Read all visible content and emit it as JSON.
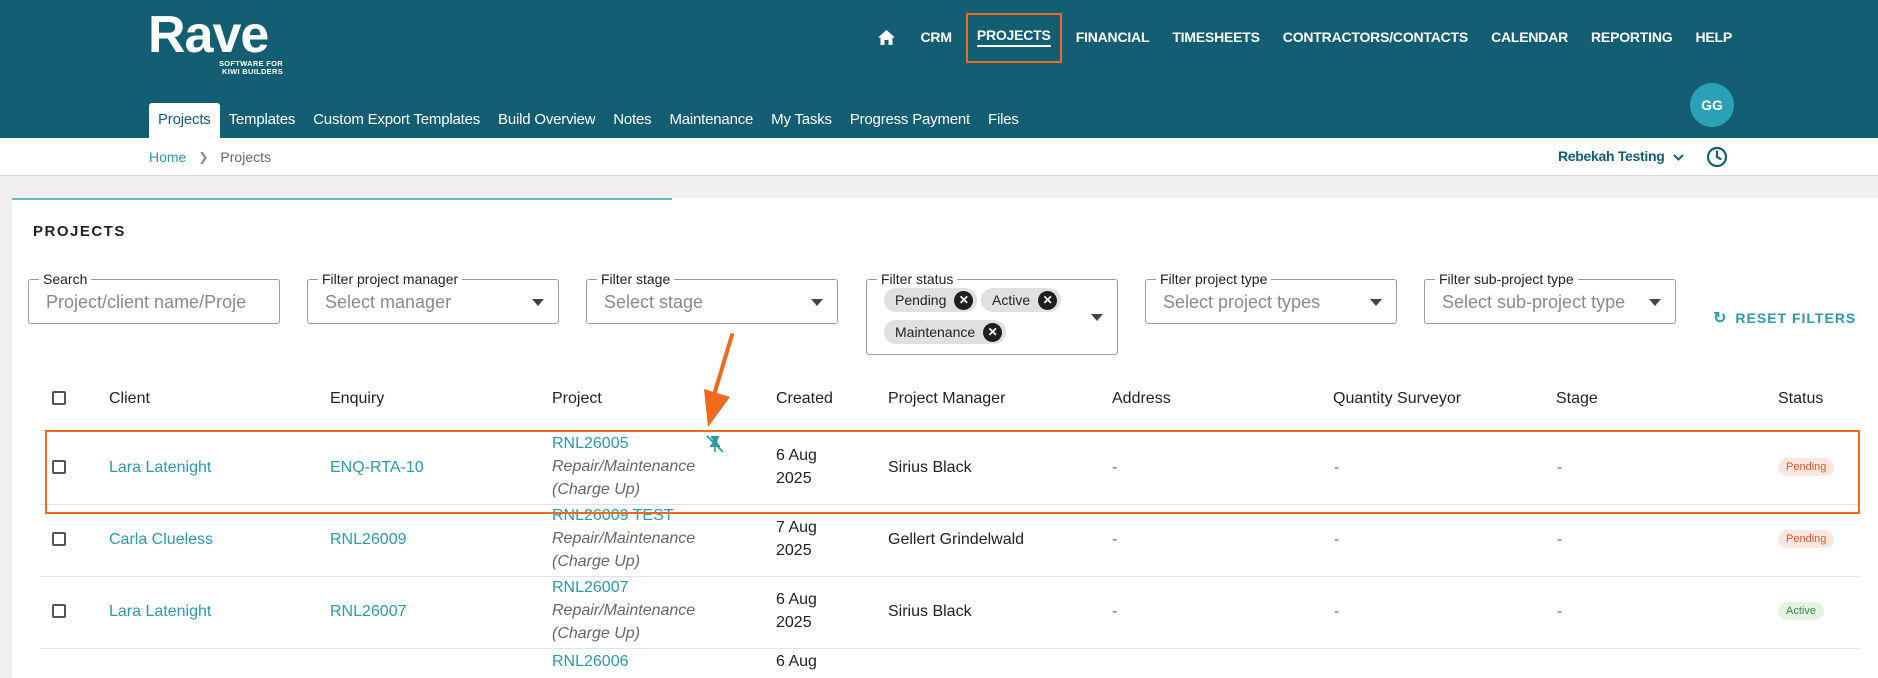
{
  "app": {
    "logo_main": "Rave",
    "logo_sub_1": "SOFTWARE FOR",
    "logo_sub_2": "KIWI BUILDERS"
  },
  "main_nav": [
    "CRM",
    "PROJECTS",
    "FINANCIAL",
    "TIMESHEETS",
    "CONTRACTORS/CONTACTS",
    "CALENDAR",
    "REPORTING",
    "HELP"
  ],
  "user": {
    "initials": "GG",
    "tenant": "Rebekah Testing"
  },
  "sub_nav": [
    "Projects",
    "Templates",
    "Custom Export Templates",
    "Build Overview",
    "Notes",
    "Maintenance",
    "My Tasks",
    "Progress Payment",
    "Files"
  ],
  "breadcrumb": {
    "home": "Home",
    "current": "Projects"
  },
  "page_title": "PROJECTS",
  "filters": {
    "search": {
      "label": "Search",
      "placeholder": "Project/client name/Proje"
    },
    "manager": {
      "label": "Filter project manager",
      "placeholder": "Select manager"
    },
    "stage": {
      "label": "Filter stage",
      "placeholder": "Select stage"
    },
    "status": {
      "label": "Filter status",
      "chips": [
        "Pending",
        "Active",
        "Maintenance"
      ]
    },
    "type": {
      "label": "Filter project type",
      "placeholder": "Select project types"
    },
    "subtype": {
      "label": "Filter sub-project type",
      "placeholder": "Select sub-project type"
    },
    "reset": "RESET FILTERS"
  },
  "table": {
    "headers": [
      "Client",
      "Enquiry",
      "Project",
      "Created",
      "Project Manager",
      "Address",
      "Quantity Surveyor",
      "Stage",
      "Status"
    ],
    "rows": [
      {
        "client": "Lara Latenight",
        "enquiry": "ENQ-RTA-10",
        "project_code": "RNL26005",
        "project_type_1": "Repair/Maintenance",
        "project_type_2": "(Charge Up)",
        "created_1": "6 Aug",
        "created_2": "2025",
        "manager": "Sirius Black",
        "address": "-",
        "qs": "-",
        "stage": "-",
        "status": "Pending"
      },
      {
        "client": "Carla Clueless",
        "enquiry": "RNL26009",
        "project_code": "RNL26009 TEST",
        "project_type_1": "Repair/Maintenance",
        "project_type_2": "(Charge Up)",
        "created_1": "7 Aug",
        "created_2": "2025",
        "manager": "Gellert Grindelwald",
        "address": "-",
        "qs": "-",
        "stage": "-",
        "status": "Pending"
      },
      {
        "client": "Lara Latenight",
        "enquiry": "RNL26007",
        "project_code": "RNL26007",
        "project_type_1": "Repair/Maintenance",
        "project_type_2": "(Charge Up)",
        "created_1": "6 Aug",
        "created_2": "2025",
        "manager": "Sirius Black",
        "address": "-",
        "qs": "-",
        "stage": "-",
        "status": "Active"
      },
      {
        "project_code": "RNL26006",
        "created_1": "6 Aug"
      }
    ]
  },
  "colors": {
    "header": "#135e73",
    "accent": "#2a9aad",
    "highlight": "#f06a1d"
  }
}
